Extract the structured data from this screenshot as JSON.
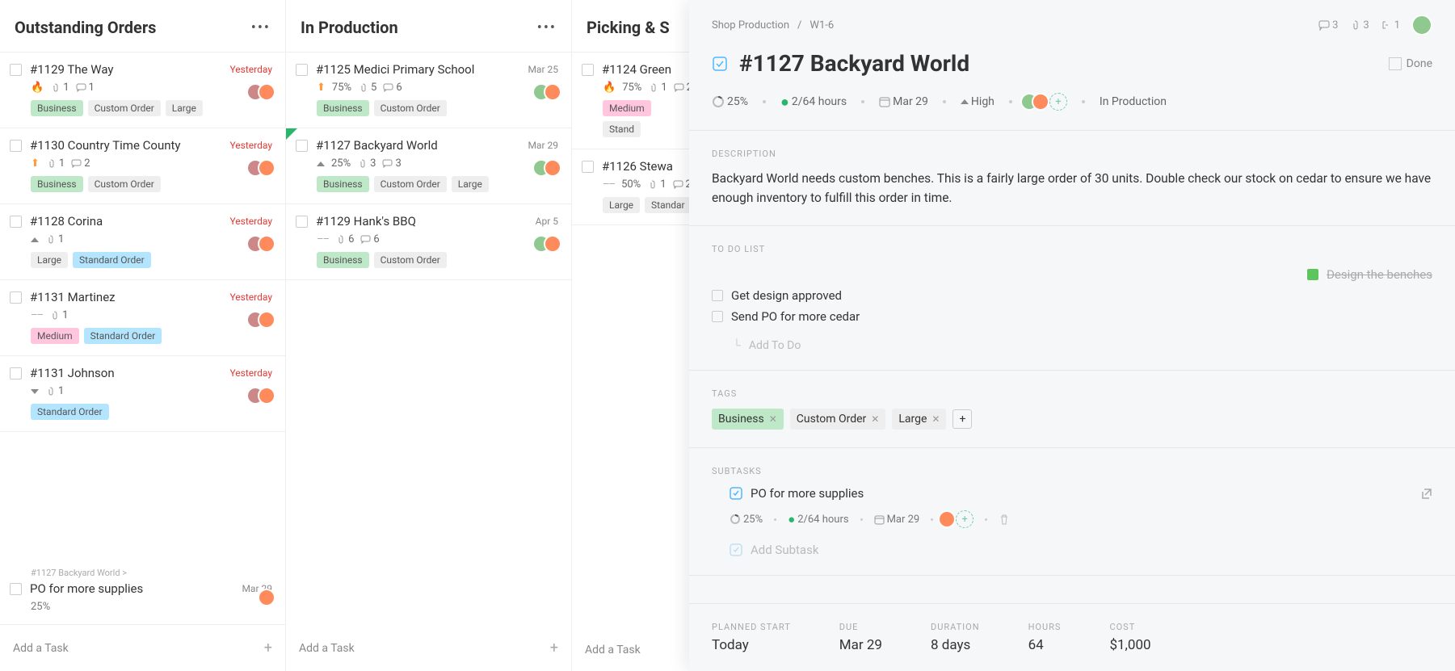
{
  "columns": [
    {
      "title": "Outstanding Orders"
    },
    {
      "title": "In Production"
    },
    {
      "title": "Picking & S"
    }
  ],
  "col0": {
    "cards": [
      {
        "title": "#1129 The Way",
        "date": "Yesterday",
        "red": true,
        "att": "1",
        "com": "1",
        "tags": [
          {
            "t": "Business",
            "c": "biz"
          },
          {
            "t": "Custom Order"
          },
          {
            "t": "Large"
          }
        ],
        "ptype": "flame"
      },
      {
        "title": "#1130 Country Time County",
        "date": "Yesterday",
        "red": true,
        "att": "1",
        "com": "2",
        "tags": [
          {
            "t": "Business",
            "c": "biz"
          },
          {
            "t": "Custom Order"
          }
        ],
        "ptype": "up"
      },
      {
        "title": "#1128 Corina",
        "date": "Yesterday",
        "red": true,
        "att": "1",
        "tags": [
          {
            "t": "Large"
          },
          {
            "t": "Standard Order",
            "c": "std"
          }
        ],
        "ptype": "tri"
      },
      {
        "title": "#1131 Martinez",
        "date": "Yesterday",
        "red": true,
        "att": "1",
        "tags": [
          {
            "t": "Medium",
            "c": "med"
          },
          {
            "t": "Standard Order",
            "c": "std"
          }
        ],
        "ptype": "dash"
      },
      {
        "title": "#1131 Johnson",
        "date": "Yesterday",
        "red": true,
        "att": "1",
        "tags": [
          {
            "t": "Standard Order",
            "c": "std"
          }
        ],
        "ptype": "tridown"
      }
    ],
    "sub": {
      "parent": "#1127 Backyard World >",
      "title": "PO for more supplies",
      "date": "Mar 29",
      "prog": "25%"
    },
    "addtask": "Add a Task"
  },
  "col1": {
    "cards": [
      {
        "title": "#1125 Medici Primary School",
        "date": "Mar 25",
        "att": "5",
        "com": "6",
        "prog": "75%",
        "tags": [
          {
            "t": "Business",
            "c": "biz"
          },
          {
            "t": "Custom Order"
          }
        ],
        "ptype": "up"
      },
      {
        "title": "#1127 Backyard World",
        "date": "Mar 29",
        "att": "3",
        "com": "3",
        "prog": "25%",
        "tags": [
          {
            "t": "Business",
            "c": "biz"
          },
          {
            "t": "Custom Order"
          },
          {
            "t": "Large"
          }
        ],
        "ptype": "tri",
        "corner": true
      },
      {
        "title": "#1129 Hank's BBQ",
        "date": "Apr 5",
        "att": "6",
        "com": "6",
        "tags": [
          {
            "t": "Business",
            "c": "biz"
          },
          {
            "t": "Custom Order"
          }
        ],
        "ptype": "dash"
      }
    ],
    "addtask": "Add a Task"
  },
  "col2": {
    "cards": [
      {
        "title": "#1124 Green",
        "prog": "75%",
        "att": "1",
        "com": "2",
        "tags": [
          {
            "t": "Medium",
            "c": "med"
          },
          {
            "t": "Stand"
          }
        ],
        "ptype": "flame"
      },
      {
        "title": "#1126 Stewa",
        "prog": "50%",
        "att": "1",
        "com": "2",
        "tags": [
          {
            "t": "Large"
          },
          {
            "t": "Standar"
          }
        ],
        "ptype": "dash"
      }
    ],
    "addtask": "Add a Task"
  },
  "panel": {
    "breadcrumb1": "Shop Production",
    "breadcrumb2": "W1-6",
    "hc_com": "3",
    "hc_att": "3",
    "hc_sub": "1",
    "title": "#1127 Backyard World",
    "done": "Done",
    "prog": "25%",
    "hours": "2/64 hours",
    "date": "Mar 29",
    "prio": "High",
    "status": "In Production",
    "descLabel": "DESCRIPTION",
    "desc": "Backyard World needs custom benches. This is a fairly large order of 30 units. Double check our stock on cedar to ensure we have enough inventory to fulfill this order in time.",
    "todoLabel": "TO DO LIST",
    "todo": [
      {
        "t": "Design the benches",
        "done": true
      },
      {
        "t": "Get design approved"
      },
      {
        "t": "Send PO for more cedar"
      }
    ],
    "addTodo": "Add To Do",
    "tagsLabel": "TAGS",
    "tags": [
      {
        "t": "Business",
        "c": "biz"
      },
      {
        "t": "Custom Order"
      },
      {
        "t": "Large"
      }
    ],
    "subLabel": "SUBTASKS",
    "subtask": {
      "title": "PO for more supplies",
      "prog": "25%",
      "hours": "2/64 hours",
      "date": "Mar 29"
    },
    "addSub": "Add Subtask",
    "footer": {
      "plannedL": "PLANNED START",
      "plannedV": "Today",
      "dueL": "DUE",
      "dueV": "Mar 29",
      "durL": "DURATION",
      "durV": "8 days",
      "hrsL": "HOURS",
      "hrsV": "64",
      "costL": "COST",
      "costV": "$1,000"
    }
  }
}
